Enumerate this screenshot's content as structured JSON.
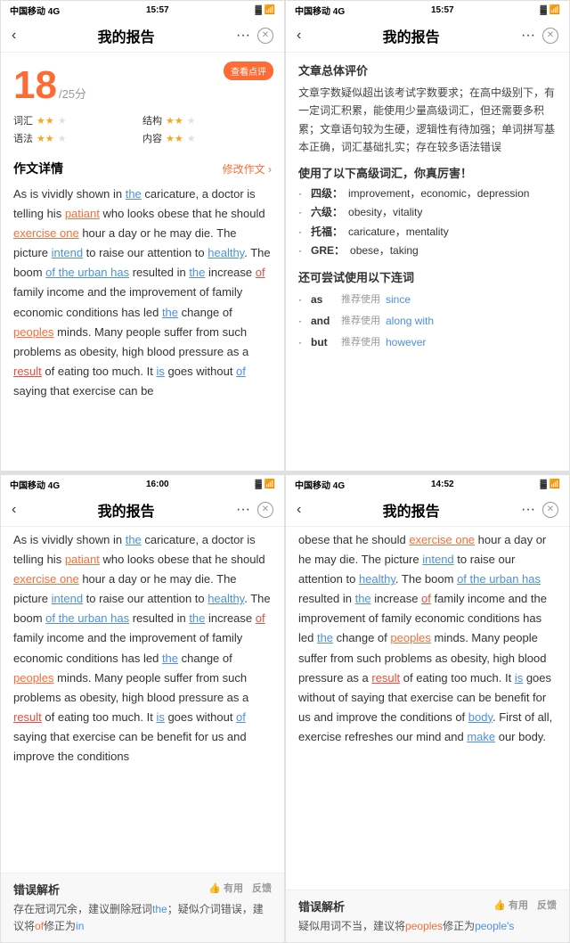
{
  "panels": {
    "topLeft": {
      "statusBar": {
        "carrier": "中国移动 4G",
        "time": "15:57",
        "batteryIcon": "▓"
      },
      "navBar": {
        "backLabel": "‹",
        "title": "我的报告",
        "menuLabel": "···"
      },
      "scoreCard": {
        "viewReviewLabel": "查看点评",
        "scoreNum": "18",
        "scoreDenom": "/25分",
        "metaItems": [
          {
            "label": "词汇",
            "stars": 2,
            "total": 3
          },
          {
            "label": "结构",
            "stars": 2,
            "total": 3
          },
          {
            "label": "语法",
            "stars": 2,
            "total": 3
          },
          {
            "label": "内容",
            "stars": 2,
            "total": 3
          }
        ]
      },
      "essaySection": {
        "sectionTitle": "作文详情",
        "actionLabel": "修改作文 ›",
        "text": "As is vividly shown in the caricature, a doctor is telling his patiant who looks obese that he should exercise one hour a day or he may die. The picture intend to raise our attention to healthy. The boom of the urban has resulted in the increase of family income and the improvement of family economic conditions has led the change of peoples minds. Many people suffer from such problems as obesity, high blood pressure as a result of eating too much. It is goes without of saying that exercise can be"
      }
    },
    "topRight": {
      "statusBar": {
        "carrier": "中国移动 4G",
        "time": "15:57"
      },
      "navBar": {
        "backLabel": "‹",
        "title": "我的报告",
        "menuLabel": "···"
      },
      "overallTitle": "文章总体评价",
      "overallText": "文章字数疑似超出该考试字数要求；在高中级别下，有一定词汇积累，能使用少量高级词汇，但还需要多积累；文章语句较为生硬，逻辑性有待加强；单词拼写基本正确，词汇基础扎实；存在较多语法错误",
      "vocabSectionTitle": "使用了以下高级词汇，你真厉害！",
      "vocabItems": [
        {
          "level": "四级：",
          "words": "improvement，economic，depression"
        },
        {
          "level": "六级：",
          "words": "obesity，vitality"
        },
        {
          "level": "托福：",
          "words": "caricature，mentality"
        },
        {
          "level": "GRE：",
          "words": "obese，taking"
        }
      ],
      "connectorSectionTitle": "还可尝试使用以下连词",
      "connectorItems": [
        {
          "word": "as",
          "recommend": "推荐使用",
          "suggestion": "since"
        },
        {
          "word": "and",
          "recommend": "推荐使用",
          "suggestion": "along with"
        },
        {
          "word": "but",
          "recommend": "推荐使用",
          "suggestion": "however"
        }
      ]
    },
    "bottomLeft": {
      "statusBar": {
        "carrier": "中国移动 4G",
        "time": "16:00"
      },
      "navBar": {
        "backLabel": "‹",
        "title": "我的报告",
        "menuLabel": "···"
      },
      "essayText": "As is vividly shown in the caricature, a doctor is telling his patiant who looks obese that he should exercise one hour a day or he may die. The picture intend to raise our attention to healthy. The boom of the urban has resulted in the increase of family income and the improvement of family economic conditions has led the change of peoples minds. Many people suffer from such problems as obesity, high blood pressure as a result of eating too much. It is goes without of saying that exercise can be benefit for us and improve the conditions",
      "errorSection": {
        "title": "错误解析",
        "feedbackItems": [
          "有用",
          "反馈"
        ],
        "errorText": "存在冠词冗余，建议删除冠词the；疑似介词错误，建议将of修正为in"
      }
    },
    "bottomRight": {
      "statusBar": {
        "carrier": "中国移动 4G",
        "time": "14:52"
      },
      "navBar": {
        "backLabel": "‹",
        "title": "我的报告",
        "menuLabel": "···"
      },
      "essayText": "obese that he should exercise one hour a day or he may die. The picture intend to raise our attention to healthy. The boom of the urban has resulted in the increase of family income and the improvement of family economic conditions has led the change of peoples minds. Many people suffer from such problems as obesity, high blood pressure as a result of eating too much. It is goes without of saying that exercise can be benefit for us and improve the conditions of body. First of all, exercise refreshes our mind and make our body.",
      "errorSection": {
        "title": "错误解析",
        "feedbackItems": [
          "有用",
          "反馈"
        ],
        "errorText": "疑似用词不当，建议将peoples修正为people's"
      }
    }
  }
}
